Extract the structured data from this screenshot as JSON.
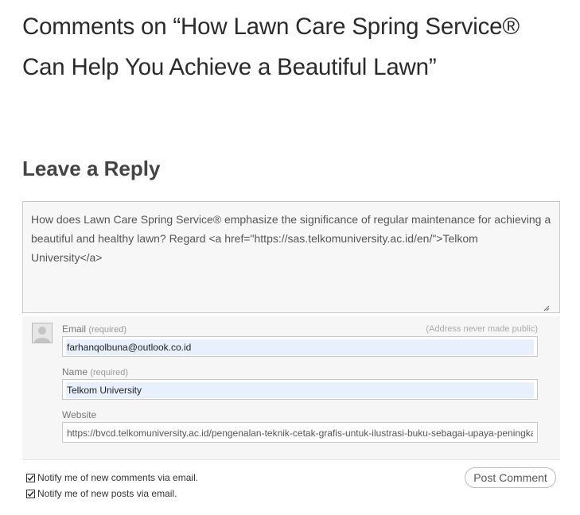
{
  "comments_heading": {
    "line1": "Comments on “How Lawn Care Spring Service®",
    "line2": "Can Help You Achieve a Beautiful Lawn”"
  },
  "reply": {
    "title": "Leave a Reply",
    "comment_text": "How does Lawn Care Spring Service® emphasize the significance of regular maintenance for achieving a beautiful and healthy lawn? Regard <a href=\"https://sas.telkomuniversity.ac.id/en/\">Telkom University</a>"
  },
  "form": {
    "email": {
      "label": "Email",
      "required": "(required)",
      "note": "(Address never made public)",
      "value": "farhanqolbuna@outlook.co.id"
    },
    "name": {
      "label": "Name",
      "required": "(required)",
      "value": "Telkom University"
    },
    "website": {
      "label": "Website",
      "value": "https://bvcd.telkomuniversity.ac.id/pengenalan-teknik-cetak-grafis-untuk-ilustrasi-buku-sebagai-upaya-peningkatan"
    }
  },
  "notify": {
    "comments_label": "Notify me of new comments via email.",
    "comments_checked": true,
    "posts_label": "Notify me of new posts via email.",
    "posts_checked": true
  },
  "submit_label": "Post Comment",
  "icons": {
    "avatar": "default-avatar-icon",
    "check": "checkmark-icon",
    "grip": "resize-grip-icon"
  },
  "colors": {
    "heading": "#2b2b2b",
    "panel_bg": "#f6f6f6",
    "autofill_bg": "#e8f0fe"
  }
}
